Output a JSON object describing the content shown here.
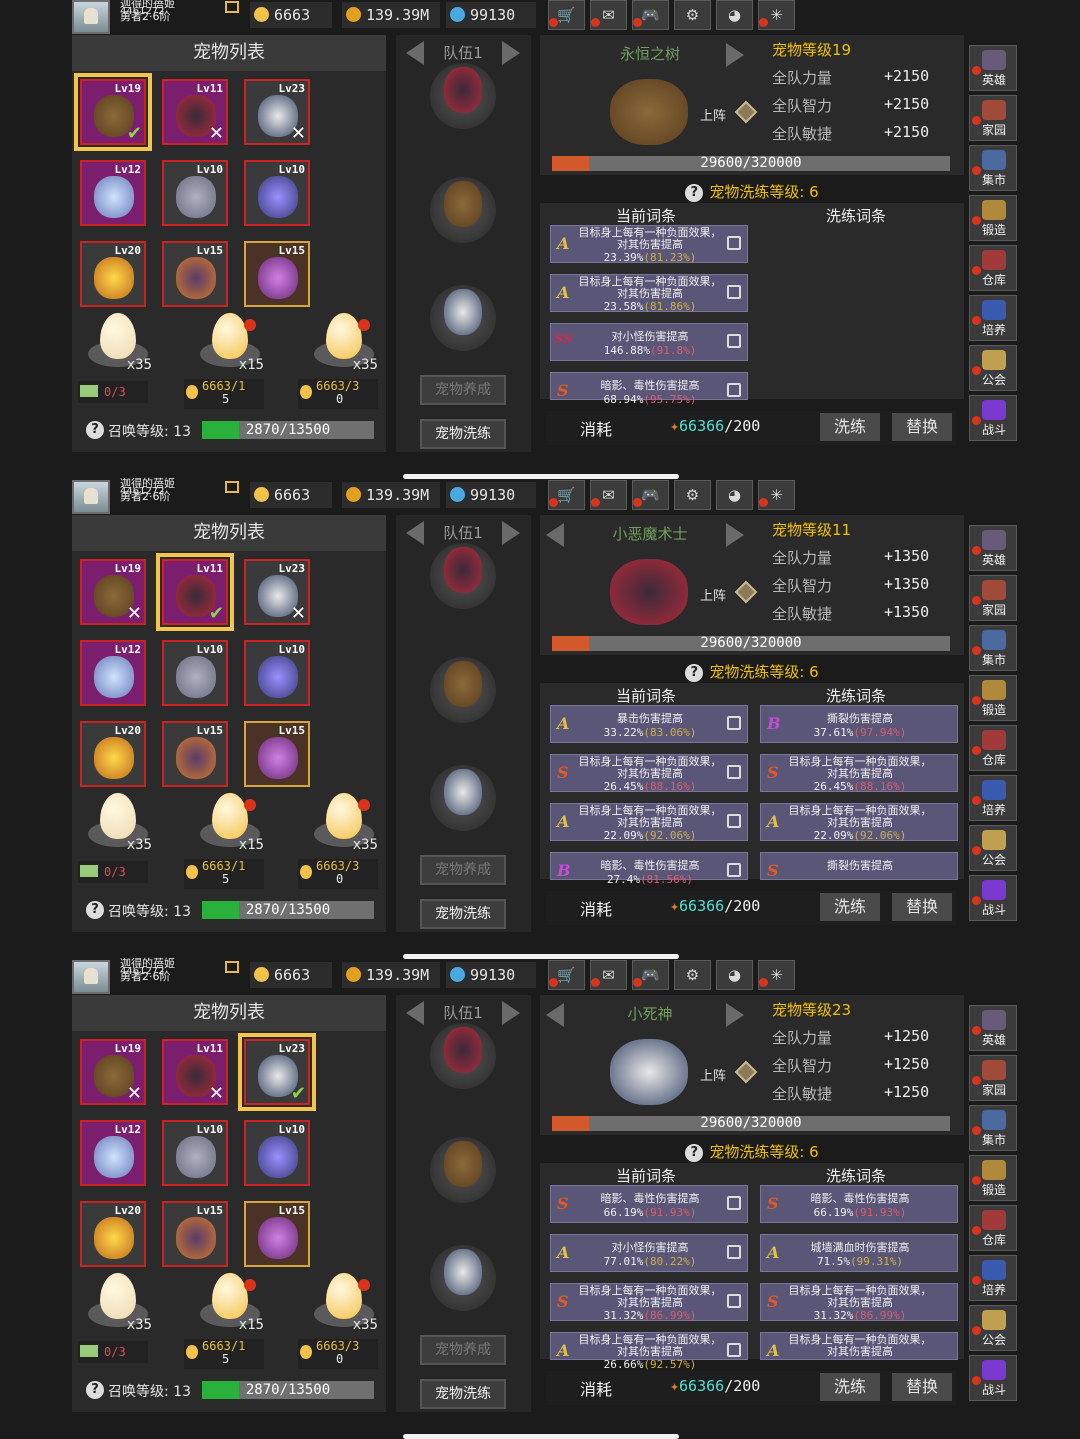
{
  "player": {
    "name": "迦得的蓓姬",
    "id": "4461272",
    "rank": "勇者2·6阶"
  },
  "resources": {
    "gold": "6663",
    "coins": "139.39M",
    "gems": "99130"
  },
  "menu_icons": [
    "shop-icon",
    "mail-icon",
    "gamepad-icon",
    "gear-icon",
    "colorwheel-icon",
    "spider-icon"
  ],
  "sidebar": [
    {
      "label": "英雄",
      "icon": "helmet-icon"
    },
    {
      "label": "家园",
      "icon": "house-icon"
    },
    {
      "label": "集市",
      "icon": "market-icon"
    },
    {
      "label": "锻造",
      "icon": "anvil-icon"
    },
    {
      "label": "仓库",
      "icon": "chest-icon"
    },
    {
      "label": "培养",
      "icon": "wizard-icon"
    },
    {
      "label": "公会",
      "icon": "guild-icon"
    },
    {
      "label": "战斗",
      "icon": "vortex-icon"
    }
  ],
  "pet_list_title": "宠物列表",
  "pet_levels": [
    "Lv19",
    "Lv11",
    "Lv23",
    "Lv12",
    "Lv10",
    "Lv10",
    "Lv20",
    "Lv15",
    "Lv15"
  ],
  "eggs": {
    "counts": [
      "x35",
      "x15",
      "x35"
    ],
    "egg1_info": "0/3",
    "egg2_info": "6663/1",
    "egg2_sub": "5",
    "egg3_info": "6663/3",
    "egg3_sub": "0"
  },
  "summon": {
    "label": "召唤等级: 13",
    "progress": "2870/13500",
    "fraction": 0.2126
  },
  "team": {
    "label": "队伍1",
    "btn_raise": "宠物养成",
    "btn_wash": "宠物洗练"
  },
  "labels": {
    "stat_str": "全队力量",
    "stat_int": "全队智力",
    "stat_agi": "全队敏捷",
    "go_up": "上阵",
    "exp": "29600/320000",
    "exp_fraction": 0.0925,
    "wash_level": "宠物洗练等级: 6",
    "current_affix": "当前词条",
    "wash_affix": "洗练词条",
    "cost": "消耗",
    "cost_have": "66366",
    "cost_need": "/200",
    "btn_wash": "洗练",
    "btn_replace": "替换"
  },
  "screens": [
    {
      "pet_name": "永恒之树",
      "pet_level": "宠物等级19",
      "stat_bonus": "+2150",
      "selected_index": 0,
      "current": [
        {
          "grade": "A",
          "text": "目标身上每有一种负面效果，对其伤害提高",
          "value": "23.39%",
          "pct": "(81.23%)"
        },
        {
          "grade": "A",
          "text": "目标身上每有一种负面效果，对其伤害提高",
          "value": "23.58%",
          "pct": "(81.86%)"
        },
        {
          "grade": "SS",
          "text": "对小怪伤害提高",
          "value": "146.88%",
          "pct": "(91.8%)"
        },
        {
          "grade": "S",
          "text": "暗影、毒性伤害提高",
          "value": "68.94%",
          "pct": "(95.75%)"
        }
      ],
      "wash": []
    },
    {
      "pet_name": "小恶魔术士",
      "pet_level": "宠物等级11",
      "stat_bonus": "+1350",
      "selected_index": 1,
      "current": [
        {
          "grade": "A",
          "text": "暴击伤害提高",
          "value": "33.22%",
          "pct": "(83.06%)"
        },
        {
          "grade": "S",
          "text": "目标身上每有一种负面效果，对其伤害提高",
          "value": "26.45%",
          "pct": "(88.16%)"
        },
        {
          "grade": "A",
          "text": "目标身上每有一种负面效果，对其伤害提高",
          "value": "22.09%",
          "pct": "(92.06%)"
        },
        {
          "grade": "B",
          "text": "暗影、毒性伤害提高",
          "value": "27.4%",
          "pct": "(81.56%)"
        }
      ],
      "wash": [
        {
          "grade": "B",
          "text": "撕裂伤害提高",
          "value": "37.61%",
          "pct": "(97.94%)"
        },
        {
          "grade": "S",
          "text": "目标身上每有一种负面效果，对其伤害提高",
          "value": "26.45%",
          "pct": "(88.16%)"
        },
        {
          "grade": "A",
          "text": "目标身上每有一种负面效果，对其伤害提高",
          "value": "22.09%",
          "pct": "(92.06%)"
        },
        {
          "grade": "S",
          "text": "撕裂伤害提高",
          "value": "",
          "pct": ""
        }
      ]
    },
    {
      "pet_name": "小死神",
      "pet_level": "宠物等级23",
      "stat_bonus": "+1250",
      "selected_index": 2,
      "current": [
        {
          "grade": "S",
          "text": "暗影、毒性伤害提高",
          "value": "66.19%",
          "pct": "(91.93%)"
        },
        {
          "grade": "A",
          "text": "对小怪伤害提高",
          "value": "77.01%",
          "pct": "(80.22%)"
        },
        {
          "grade": "S",
          "text": "目标身上每有一种负面效果，对其伤害提高",
          "value": "31.32%",
          "pct": "(86.99%)"
        },
        {
          "grade": "A",
          "text": "目标身上每有一种负面效果，对其伤害提高",
          "value": "26.66%",
          "pct": "(92.57%)"
        }
      ],
      "wash": [
        {
          "grade": "S",
          "text": "暗影、毒性伤害提高",
          "value": "66.19%",
          "pct": "(91.93%)"
        },
        {
          "grade": "A",
          "text": "城墙满血时伤害提高",
          "value": "71.5%",
          "pct": "(99.31%)"
        },
        {
          "grade": "S",
          "text": "目标身上每有一种负面效果，对其伤害提高",
          "value": "31.32%",
          "pct": "(86.99%)"
        },
        {
          "grade": "A",
          "text": "目标身上每有一种负面效果，对其伤害提高",
          "value": "",
          "pct": ""
        }
      ]
    }
  ],
  "colors": {
    "gold": "#f0c000",
    "green_name": "#6fa05a",
    "cost": "#4de0d0",
    "pct_red": "#e05a6a",
    "pct_yellow": "#d0b040"
  }
}
